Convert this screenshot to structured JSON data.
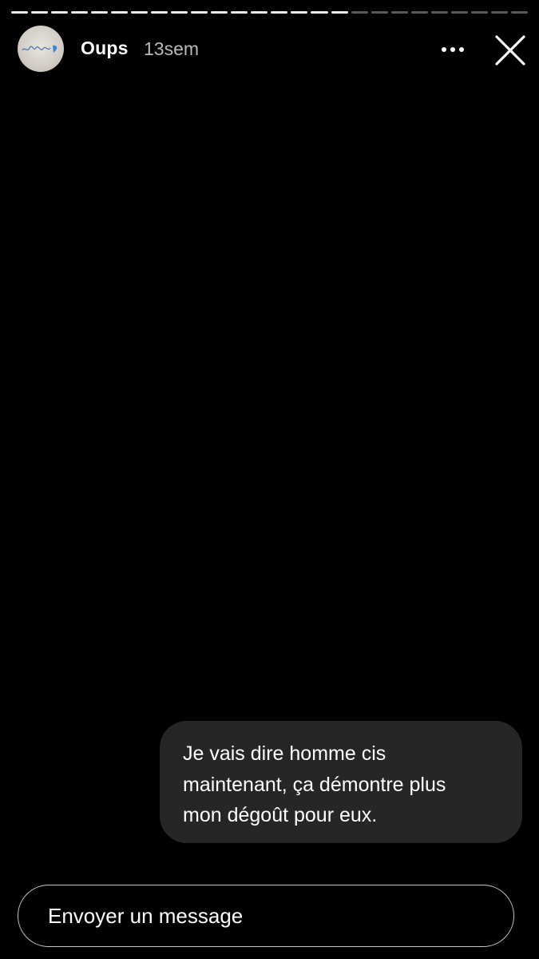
{
  "story": {
    "progress": {
      "total_segments": 26,
      "completed_segments": 17
    }
  },
  "header": {
    "username": "Oups",
    "timestamp": "13sem",
    "avatar_icon": "profile-picture"
  },
  "icons": {
    "more": "more-horizontal-icon",
    "close": "close-icon"
  },
  "message": {
    "text": "Je vais dire homme cis\nmaintenant, ça démontre plus\nmon dégoût pour eux."
  },
  "reply": {
    "placeholder": "Envoyer un message"
  },
  "colors": {
    "background": "#000000",
    "bubble": "#262626",
    "text": "#ffffff"
  }
}
